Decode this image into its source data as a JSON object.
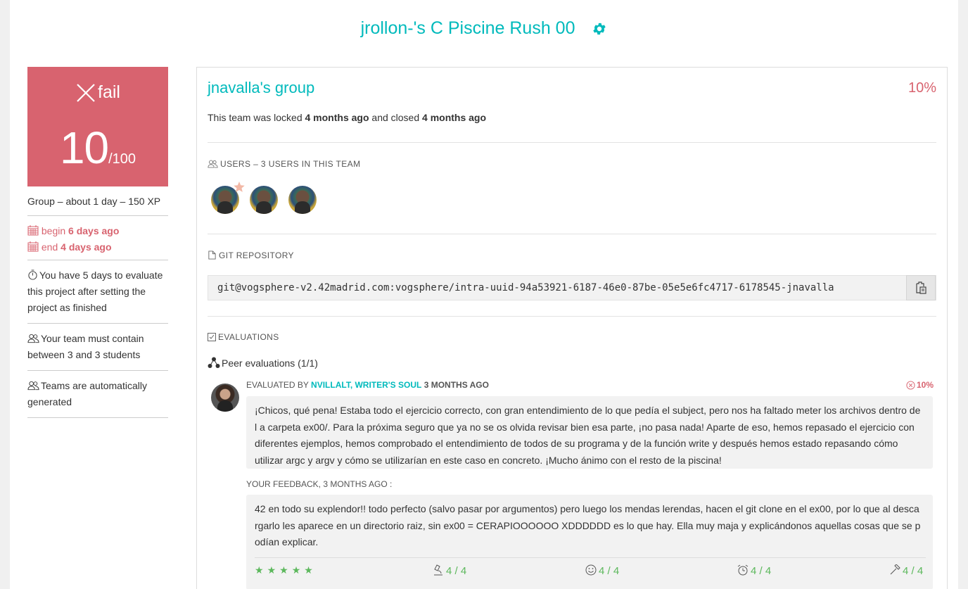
{
  "page": {
    "title": "jrollon-'s C Piscine Rush 00"
  },
  "left": {
    "status": "fail",
    "score": "10",
    "score_max": "/100",
    "meta": "Group – about 1 day – 150 XP",
    "begin_label": "begin",
    "begin_value": "6 days ago",
    "end_label": "end",
    "end_value": "4 days ago",
    "info_evaluate": "You have 5 days to evaluate this project after setting the project as finished",
    "info_team_size": "Your team must contain between 3 and 3 students",
    "info_auto": "Teams are automatically generated"
  },
  "team": {
    "name": "jnavalla's group",
    "percent": "10%",
    "locked_prefix": "This team was locked",
    "locked_ago": "4 months ago",
    "closed_prefix": "and closed",
    "closed_ago": "4 months ago",
    "users_label": "USERS – 3 USERS IN THIS TEAM",
    "repo_label": "GIT REPOSITORY",
    "repo_url": "git@vogsphere-v2.42madrid.com:vogsphere/intra-uuid-94a53921-6187-46e0-87be-05e5e6fc4717-6178545-jnavalla",
    "evaluations_label": "EVALUATIONS",
    "peer_label": "Peer evaluations (1/1)"
  },
  "evaluation": {
    "evaluated_by": "EVALUATED BY",
    "evaluator": "NVILLALT, WRITER'S SOUL",
    "ago": "3 MONTHS AGO",
    "percent": "10%",
    "comment": "¡Chicos, qué pena! Estaba todo el ejercicio correcto, con gran entendimiento de lo que pedía el subject, pero nos ha faltado meter los archivos dentro de l a carpeta ex00/. Para la próxima seguro que ya no se os olvida revisar bien esa parte, ¡no pasa nada! Aparte de eso, hemos repasado el ejercicio con diferentes ejemplos, hemos comprobado el entendimiento de todos de su programa y de la función write y después hemos estado repasando cómo utilizar argc y argv y cómo se utilizarían en este caso en concreto. ¡Mucho ánimo con el resto de la piscina!",
    "feedback_label": "YOUR FEEDBACK, 3 MONTHS AGO :",
    "feedback": "42 en todo su explendor!! todo perfecto (salvo pasar por argumentos) pero luego los mendas lerendas, hacen el git clone en el ex00, por lo que al desca rgarlo les aparece en un directorio raiz, sin ex00 = CERAPIOOOOOO XDDDDDD es lo que hay. Ella muy maja y explicándonos aquellas cosas que se p odían explicar.",
    "stars": 5,
    "rating_interest": "4 / 4",
    "rating_nice": "4 / 4",
    "rating_punctuality": "4 / 4",
    "rating_rigor": "4 / 4"
  },
  "colors": {
    "accent": "#00babc",
    "fail": "#d8636f",
    "success": "#5cb85c"
  }
}
